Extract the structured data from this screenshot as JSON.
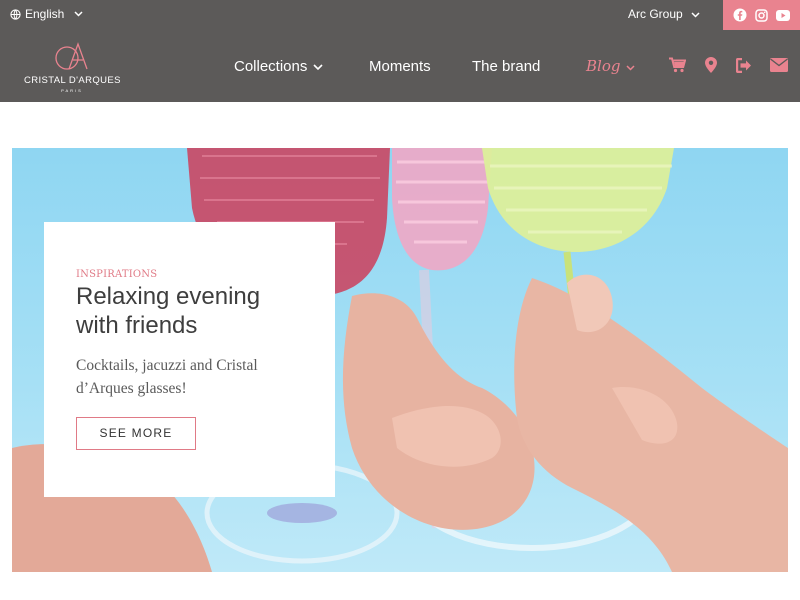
{
  "topbar": {
    "language": "English",
    "arc_group": "Arc Group",
    "bg_color": "#5c5a59",
    "social_bg": "#e9838f",
    "social_icons": [
      "facebook-icon",
      "instagram-icon",
      "youtube-icon"
    ]
  },
  "logo": {
    "name": "CRISTAL D'ARQUES",
    "sub": "PARIS"
  },
  "nav": {
    "collections": "Collections",
    "moments": "Moments",
    "brand": "The brand",
    "blog": "Blog",
    "icons": [
      "cart-icon",
      "location-pin-icon",
      "login-icon",
      "mail-icon"
    ],
    "accent": "#e9838f"
  },
  "hero": {
    "eyebrow": "INSPIRATIONS",
    "title": "Relaxing evening with friends",
    "description": "Cocktails, jacuzzi and Cristal d’Arques glasses!",
    "cta": "SEE MORE"
  }
}
